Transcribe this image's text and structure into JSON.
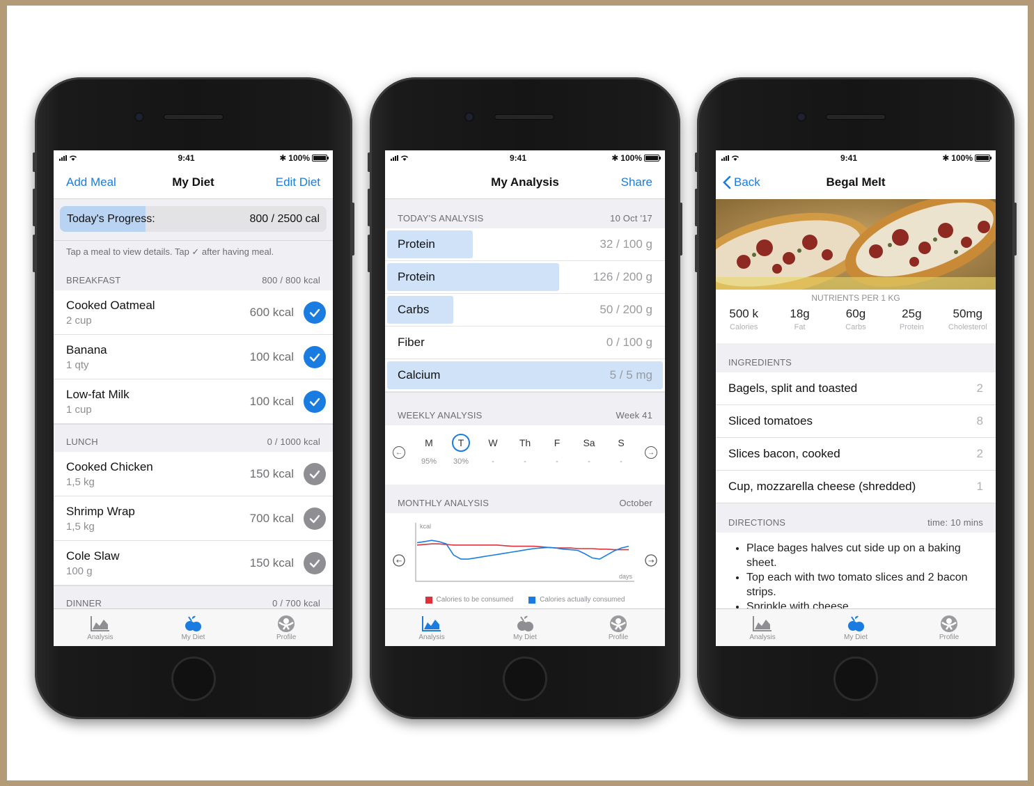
{
  "status": {
    "time": "9:41",
    "battery": "100%"
  },
  "colors": {
    "accent": "#1a7ce0",
    "progress_fill": "#b9d3f3",
    "series_target": "#e0313a",
    "series_actual": "#1a7ce0"
  },
  "phone1": {
    "nav": {
      "left": "Add Meal",
      "title": "My Diet",
      "right": "Edit Diet"
    },
    "progress": {
      "label": "Today's Progress:",
      "value": "800 / 2500 cal",
      "fraction": 0.32
    },
    "hint": "Tap a meal to view details. Tap ✓ after having meal.",
    "sections": [
      {
        "name": "BREAKFAST",
        "total": "800 / 800 kcal",
        "items": [
          {
            "name": "Cooked Oatmeal",
            "qty": "2 cup",
            "kcal": "600 kcal",
            "done": true
          },
          {
            "name": "Banana",
            "qty": "1 qty",
            "kcal": "100 kcal",
            "done": true
          },
          {
            "name": "Low-fat Milk",
            "qty": "1 cup",
            "kcal": "100 kcal",
            "done": true
          }
        ]
      },
      {
        "name": "LUNCH",
        "total": "0 / 1000 kcal",
        "items": [
          {
            "name": "Cooked Chicken",
            "qty": "1,5 kg",
            "kcal": "150 kcal",
            "done": false
          },
          {
            "name": "Shrimp Wrap",
            "qty": "1,5 kg",
            "kcal": "700 kcal",
            "done": false
          },
          {
            "name": "Cole Slaw",
            "qty": "100 g",
            "kcal": "150 kcal",
            "done": false
          }
        ]
      },
      {
        "name": "DINNER",
        "total": "0 / 700 kcal",
        "items": []
      }
    ]
  },
  "phone2": {
    "nav": {
      "title": "My Analysis",
      "right": "Share"
    },
    "today": {
      "label": "TODAY'S ANALYSIS",
      "date": "10 Oct '17"
    },
    "nutrients": [
      {
        "name": "Protein",
        "value": "32 / 100 g",
        "fraction": 0.32
      },
      {
        "name": "Protein",
        "value": "126 / 200 g",
        "fraction": 0.63
      },
      {
        "name": "Carbs",
        "value": "50 / 200 g",
        "fraction": 0.25
      },
      {
        "name": "Fiber",
        "value": "0 / 100 g",
        "fraction": 0
      },
      {
        "name": "Calcium",
        "value": "5 / 5 mg",
        "fraction": 1
      }
    ],
    "weekly": {
      "label": "WEEKLY ANALYSIS",
      "week": "Week 41",
      "days": [
        {
          "d": "M",
          "p": "95%",
          "sel": false
        },
        {
          "d": "T",
          "p": "30%",
          "sel": true
        },
        {
          "d": "W",
          "p": "-",
          "sel": false
        },
        {
          "d": "Th",
          "p": "-",
          "sel": false
        },
        {
          "d": "F",
          "p": "-",
          "sel": false
        },
        {
          "d": "Sa",
          "p": "-",
          "sel": false
        },
        {
          "d": "S",
          "p": "-",
          "sel": false
        }
      ]
    },
    "monthly": {
      "label": "MONTHLY ANALYSIS",
      "month": "October"
    },
    "chart_data": {
      "type": "line",
      "xlabel": "days",
      "ylabel": "kcal",
      "x": [
        1,
        2,
        3,
        4,
        5,
        6,
        7,
        8,
        9,
        10,
        11,
        12,
        13,
        14,
        15,
        16,
        17,
        18,
        19,
        20,
        21,
        22,
        23,
        24,
        25,
        26,
        27,
        28,
        29,
        30
      ],
      "series": [
        {
          "name": "Calories to be consumed",
          "values": [
            0.62,
            0.63,
            0.64,
            0.64,
            0.63,
            0.62,
            0.62,
            0.62,
            0.62,
            0.62,
            0.62,
            0.62,
            0.61,
            0.6,
            0.6,
            0.6,
            0.6,
            0.59,
            0.58,
            0.57,
            0.57,
            0.57,
            0.56,
            0.56,
            0.56,
            0.55,
            0.55,
            0.54,
            0.54,
            0.54
          ]
        },
        {
          "name": "Calories actually consumed",
          "values": [
            0.66,
            0.68,
            0.7,
            0.68,
            0.64,
            0.45,
            0.38,
            0.38,
            0.4,
            0.42,
            0.44,
            0.46,
            0.48,
            0.5,
            0.52,
            0.54,
            0.56,
            0.57,
            0.58,
            0.57,
            0.55,
            0.54,
            0.53,
            0.47,
            0.4,
            0.38,
            0.45,
            0.52,
            0.57,
            0.6
          ]
        }
      ],
      "grid": false,
      "legend": "bottom"
    }
  },
  "phone3": {
    "nav": {
      "back": "Back",
      "title": "Begal Melt"
    },
    "nutrients_caption": "NUTRIENTS PER 1 KG",
    "nutrients": [
      {
        "v": "500 k",
        "l": "Calories"
      },
      {
        "v": "18g",
        "l": "Fat"
      },
      {
        "v": "60g",
        "l": "Carbs"
      },
      {
        "v": "25g",
        "l": "Protein"
      },
      {
        "v": "50mg",
        "l": "Cholesterol"
      }
    ],
    "ingredients_label": "INGREDIENTS",
    "ingredients": [
      {
        "name": "Bagels, split and toasted",
        "count": "2"
      },
      {
        "name": "Sliced tomatoes",
        "count": "8"
      },
      {
        "name": "Slices bacon, cooked",
        "count": "2"
      },
      {
        "name": "Cup, mozzarella cheese (shredded)",
        "count": "1"
      }
    ],
    "directions_label": "DIRECTIONS",
    "directions_time": "time: 10 mins",
    "directions": [
      "Place bages halves cut side up on a baking sheet.",
      "Top each with two tomato slices and 2 bacon strips.",
      "Sprinkle with cheese."
    ]
  },
  "tabs": [
    {
      "label": "Analysis",
      "icon": "chart-icon"
    },
    {
      "label": "My Diet",
      "icon": "apple-icon"
    },
    {
      "label": "Profile",
      "icon": "profile-icon"
    }
  ]
}
